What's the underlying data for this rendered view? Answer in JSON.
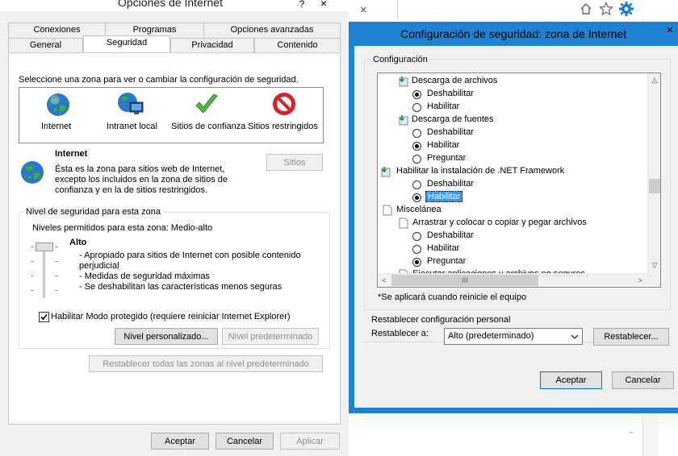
{
  "left_dialog": {
    "title": "Opciones de Internet",
    "tabs_row1": [
      "Conexiones",
      "Programas",
      "Opciones avanzadas"
    ],
    "tabs_row2": [
      "General",
      "Seguridad",
      "Privacidad",
      "Contenido"
    ],
    "zone_prompt": "Seleccione una zona para ver o cambiar la configuración de seguridad.",
    "zones": [
      "Internet",
      "Intranet local",
      "Sitios de confianza",
      "Sitios restringidos"
    ],
    "zone_title": "Internet",
    "zone_desc": [
      "Ésta es la zona para sitios web de Internet,",
      "excepto los incluidos en la zona de sitios de",
      "confianza y en la de sitios restringidos."
    ],
    "sites_button": "Sitios",
    "level_group": "Nivel de seguridad para esta zona",
    "allowed_levels": "Niveles permitidos para esta zona: Medio-alto",
    "level_name": "Alto",
    "level_bullets": [
      "- Apropiado para sitios de Internet con posible contenido",
      "perjudicial",
      "- Medidas de seguridad máximas",
      "- Se deshabilitan las características menos seguras"
    ],
    "protected_mode": "Habilitar Modo protegido (requiere reiniciar Internet Explorer)",
    "custom_level": "Nivel personalizado...",
    "default_level": "Nivel predeterminado",
    "reset_all": "Restablecer todas las zonas al nivel predeterminado",
    "ok": "Aceptar",
    "cancel": "Cancelar",
    "apply": "Aplicar",
    "close_glyph": "×",
    "help_glyph": "?"
  },
  "browser": {
    "tab_close": "×"
  },
  "right_dialog": {
    "title": "Configuración de seguridad: zona de Internet",
    "config_label": "Configuración",
    "tree": [
      {
        "type": "category",
        "label": "Descarga de archivos"
      },
      {
        "type": "option",
        "label": "Deshabilitar",
        "checked": true
      },
      {
        "type": "option",
        "label": "Habilitar",
        "checked": false
      },
      {
        "type": "category",
        "label": "Descarga de fuentes"
      },
      {
        "type": "option",
        "label": "Deshabilitar",
        "checked": false
      },
      {
        "type": "option",
        "label": "Habilitar",
        "checked": true
      },
      {
        "type": "option",
        "label": "Preguntar",
        "checked": false
      },
      {
        "type": "category",
        "label": "Habilitar la instalación de .NET Framework"
      },
      {
        "type": "option",
        "label": "Deshabilitar",
        "checked": false
      },
      {
        "type": "option",
        "label": "Habilitar",
        "checked": true,
        "selected": true
      },
      {
        "type": "category",
        "label": "Miscelánea"
      },
      {
        "type": "subcategory",
        "label": "Arrastrar y colocar o copiar y pegar archivos"
      },
      {
        "type": "option",
        "label": "Deshabilitar",
        "checked": false
      },
      {
        "type": "option",
        "label": "Habilitar",
        "checked": false
      },
      {
        "type": "option",
        "label": "Preguntar",
        "checked": true
      },
      {
        "type": "subcategory",
        "label": "Ejecutar aplicaciones y archivos no seguros"
      }
    ],
    "restart_note": "*Se aplicará cuando reinicie el equipo",
    "reset_group": "Restablecer configuración personal",
    "reset_to_label": "Restablecer a:",
    "reset_to_value": "Alto (predeterminado)",
    "reset_button": "Restablecer...",
    "ok": "Aceptar",
    "cancel": "Cancelar",
    "close_glyph": "×",
    "hscroll_thumb": "III"
  },
  "colors": {
    "accent": "#1979ca",
    "selection": "#3399ff"
  }
}
